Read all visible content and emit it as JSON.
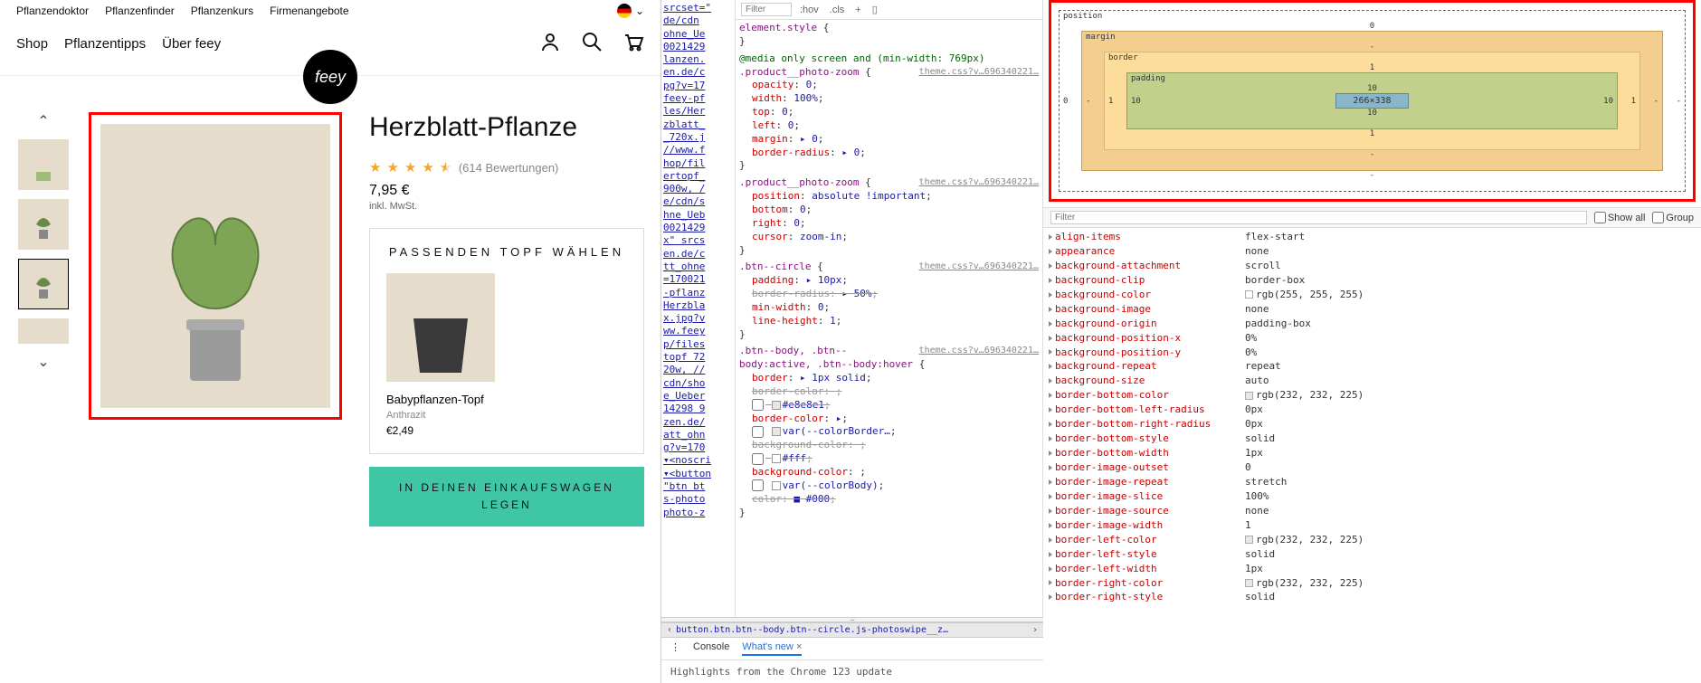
{
  "topnav": {
    "items": [
      "Pflanzendoktor",
      "Pflanzenfinder",
      "Pflanzenkurs",
      "Firmenangebote"
    ]
  },
  "mainnav": {
    "items": [
      "Shop",
      "Pflanzentipps",
      "Über feey"
    ],
    "logo": "feey"
  },
  "product": {
    "title": "Herzblatt-Pflanze",
    "review_count": "(614 Bewertungen)",
    "price": "7,95 €",
    "mwst": "inkl. MwSt.",
    "pot_section_title": "PASSENDEN TOPF WÄHLEN",
    "pot_name": "Babypflanzen-Topf",
    "pot_variant": "Anthrazit",
    "pot_price": "€2,49",
    "add_line1": "IN DEINEN EINKAUFSWAGEN",
    "add_line2": "LEGEN"
  },
  "srcset_lines": [
    "srcset=\"",
    "de/cdn",
    "ohne_Ue",
    "0021429",
    "lanzen.",
    "en.de/c",
    "pg?v=17",
    "feey-pf",
    "les/Her",
    "zblatt_",
    " _720x.j",
    "//www.f",
    "hop/fil",
    "ertopf_",
    "900w, /",
    "e/cdn/s",
    "hne_Ueb",
    "0021429",
    "x\" srcs",
    "en.de/c",
    "tt_ohne",
    "=170021",
    "-pflanz",
    "Herzbla",
    "x.jpg?v",
    "ww.feey",
    "p/files",
    "topf 72",
    "20w, //",
    "cdn/sho",
    "e_Ueber",
    "14298 9",
    "zen.de/",
    "att_ohn",
    "g?v=170",
    "▾<noscri",
    "▾<button",
    "\"btn bt",
    "s-photo",
    "photo-z"
  ],
  "styles": {
    "filter_placeholder": "Filter",
    "hov": ":hov",
    "cls": ".cls",
    "element_style": "element.style",
    "rules": [
      {
        "media": "@media only screen and (min-width: 769px)",
        "src": "theme.css?v…696340221…",
        "selector": ".product__photo-zoom",
        "props": [
          {
            "k": "opacity",
            "v": "0"
          },
          {
            "k": "width",
            "v": "100%"
          },
          {
            "k": "top",
            "v": "0"
          },
          {
            "k": "left",
            "v": "0"
          },
          {
            "k": "margin",
            "v": "▸ 0"
          },
          {
            "k": "border-radius",
            "v": "▸ 0"
          }
        ]
      },
      {
        "src": "theme.css?v…696340221…",
        "selector": ".product__photo-zoom",
        "props": [
          {
            "k": "position",
            "v": "absolute !important"
          },
          {
            "k": "bottom",
            "v": "0"
          },
          {
            "k": "right",
            "v": "0"
          },
          {
            "k": "cursor",
            "v": "zoom-in"
          }
        ]
      },
      {
        "src": "theme.css?v…696340221…",
        "selector": ".btn--circle",
        "props": [
          {
            "k": "padding",
            "v": "▸ 10px"
          },
          {
            "k": "border-radius",
            "v": "▸ 50%",
            "struck": true
          },
          {
            "k": "min-width",
            "v": "0"
          },
          {
            "k": "line-height",
            "v": "1"
          }
        ]
      },
      {
        "src": "theme.css?v…696340221…",
        "selector": ".btn--body, .btn--body:active, .btn--body:hover",
        "props": [
          {
            "k": "border",
            "v": "▸ 1px solid"
          },
          {
            "k": "border-color",
            "v": "",
            "struck": true
          },
          {
            "k": "",
            "v": "#e8e8e1",
            "swatch": "#e8e8e1",
            "struck": true,
            "checkbox": true
          },
          {
            "k": "border-color",
            "v": "▸"
          },
          {
            "k": "",
            "v": "var(--colorBorder…",
            "swatch": "#e8e8e1",
            "checkbox": true
          },
          {
            "k": "background-color",
            "v": "",
            "struck": true
          },
          {
            "k": "",
            "v": "#fff",
            "swatch": "#fff",
            "struck": true,
            "checkbox": true
          },
          {
            "k": "background-color",
            "v": ""
          },
          {
            "k": "",
            "v": "var(--colorBody)",
            "swatch": "#fff",
            "checkbox": true
          },
          {
            "k": "color",
            "v": "■ #000",
            "struck": true
          }
        ]
      }
    ],
    "breadcrumb": "button.btn.btn--body.btn--circle.js-photoswipe__z…"
  },
  "drawer": {
    "tabs": [
      "Console",
      "What's new"
    ],
    "active_tab": 1,
    "headline": "Highlights from the Chrome 123 update"
  },
  "boxmodel": {
    "position": {
      "label": "position",
      "t": "0",
      "r": "-",
      "b": "-",
      "l": "0"
    },
    "margin": {
      "label": "margin",
      "t": "-",
      "r": "-",
      "b": "-",
      "l": "-"
    },
    "border": {
      "label": "border",
      "t": "1",
      "r": "1",
      "b": "1",
      "l": "1"
    },
    "padding": {
      "label": "padding",
      "t": "10",
      "r": "10",
      "b": "10",
      "l": "10"
    },
    "content": "266×338"
  },
  "computed": {
    "filter_placeholder": "Filter",
    "showall": "Show all",
    "group": "Group",
    "rows": [
      {
        "k": "align-items",
        "v": "flex-start"
      },
      {
        "k": "appearance",
        "v": "none"
      },
      {
        "k": "background-attachment",
        "v": "scroll"
      },
      {
        "k": "background-clip",
        "v": "border-box"
      },
      {
        "k": "background-color",
        "v": "rgb(255, 255, 255)",
        "swatch": "#ffffff"
      },
      {
        "k": "background-image",
        "v": "none"
      },
      {
        "k": "background-origin",
        "v": "padding-box"
      },
      {
        "k": "background-position-x",
        "v": "0%"
      },
      {
        "k": "background-position-y",
        "v": "0%"
      },
      {
        "k": "background-repeat",
        "v": "repeat"
      },
      {
        "k": "background-size",
        "v": "auto"
      },
      {
        "k": "border-bottom-color",
        "v": "rgb(232, 232, 225)",
        "swatch": "#e8e8e1"
      },
      {
        "k": "border-bottom-left-radius",
        "v": "0px"
      },
      {
        "k": "border-bottom-right-radius",
        "v": "0px"
      },
      {
        "k": "border-bottom-style",
        "v": "solid"
      },
      {
        "k": "border-bottom-width",
        "v": "1px"
      },
      {
        "k": "border-image-outset",
        "v": "0"
      },
      {
        "k": "border-image-repeat",
        "v": "stretch"
      },
      {
        "k": "border-image-slice",
        "v": "100%"
      },
      {
        "k": "border-image-source",
        "v": "none"
      },
      {
        "k": "border-image-width",
        "v": "1"
      },
      {
        "k": "border-left-color",
        "v": "rgb(232, 232, 225)",
        "swatch": "#e8e8e1"
      },
      {
        "k": "border-left-style",
        "v": "solid"
      },
      {
        "k": "border-left-width",
        "v": "1px"
      },
      {
        "k": "border-right-color",
        "v": "rgb(232, 232, 225)",
        "swatch": "#e8e8e1"
      },
      {
        "k": "border-right-style",
        "v": "solid"
      }
    ]
  }
}
